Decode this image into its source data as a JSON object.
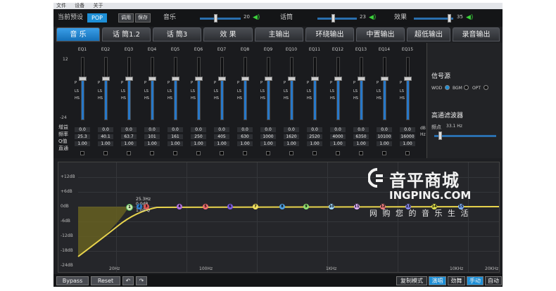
{
  "menu": [
    "文件",
    "设备",
    "关于"
  ],
  "top": {
    "preset_label": "当前预设",
    "preset_value": "POP",
    "recall": "调用",
    "save": "保存",
    "music": "音乐",
    "music_val": "20",
    "mic": "话筒",
    "mic_val": "23",
    "effect": "效果",
    "effect_val": "35"
  },
  "tabs": [
    "音 乐",
    "话 筒1.2",
    "话 筒3",
    "效 果",
    "主输出",
    "环绕输出",
    "中置输出",
    "超低输出",
    "录音输出"
  ],
  "eq": {
    "db_top": "12",
    "db_bot": "-24",
    "row_labels": [
      "增益",
      "频率",
      "Q值",
      "直通"
    ],
    "unit_db": "dB",
    "unit_hz": "Hz",
    "bands": [
      {
        "name": "EQ1",
        "gain": "0.0",
        "freq": "25.3",
        "q": "1.00"
      },
      {
        "name": "EQ2",
        "gain": "0.0",
        "freq": "40.1",
        "q": "1.00"
      },
      {
        "name": "EQ3",
        "gain": "0.0",
        "freq": "63.7",
        "q": "1.00"
      },
      {
        "name": "EQ4",
        "gain": "0.0",
        "freq": "101",
        "q": "1.00"
      },
      {
        "name": "EQ5",
        "gain": "0.0",
        "freq": "161",
        "q": "1.00"
      },
      {
        "name": "EQ6",
        "gain": "0.0",
        "freq": "250",
        "q": "1.00"
      },
      {
        "name": "EQ7",
        "gain": "0.0",
        "freq": "405",
        "q": "1.00"
      },
      {
        "name": "EQ8",
        "gain": "0.0",
        "freq": "630",
        "q": "1.00"
      },
      {
        "name": "EQ9",
        "gain": "0.0",
        "freq": "1000",
        "q": "1.00"
      },
      {
        "name": "EQ10",
        "gain": "0.0",
        "freq": "1620",
        "q": "1.00"
      },
      {
        "name": "EQ11",
        "gain": "0.0",
        "freq": "2520",
        "q": "1.00"
      },
      {
        "name": "EQ12",
        "gain": "0.0",
        "freq": "4000",
        "q": "1.00"
      },
      {
        "name": "EQ13",
        "gain": "0.0",
        "freq": "6350",
        "q": "1.00"
      },
      {
        "name": "EQ14",
        "gain": "0.0",
        "freq": "10100",
        "q": "1.00"
      },
      {
        "name": "EQ15",
        "gain": "0.0",
        "freq": "16000",
        "q": "1.00"
      }
    ]
  },
  "side": {
    "source_title": "信号源",
    "sources": [
      "WOD",
      "BGM",
      "OPT"
    ],
    "hpf_title": "高通滤波器",
    "hpf_freq_label": "频点",
    "hpf_freq": "33.1 Hz"
  },
  "graph": {
    "ylabels": [
      "+12dB",
      "+6dB",
      "0dB",
      "-6dB",
      "-12dB",
      "-18dB",
      "-24dB"
    ],
    "xlabels": [
      "20Hz",
      "100Hz",
      "1KHz",
      "10KHz",
      "20KHz"
    ],
    "tip1": "25.3Hz",
    "tip2": "0.0dB",
    "tip3": "1.00 Q"
  },
  "watermark": {
    "brand": "音平商城",
    "domain": "INGPING.COM",
    "slogan": "网 购 您 的 音 乐 生 活"
  },
  "bottom": {
    "bypass": "Bypass",
    "reset": "Reset",
    "copy": "复制模式",
    "modes": [
      "演唱",
      "劲舞",
      "手动",
      "自动"
    ]
  }
}
